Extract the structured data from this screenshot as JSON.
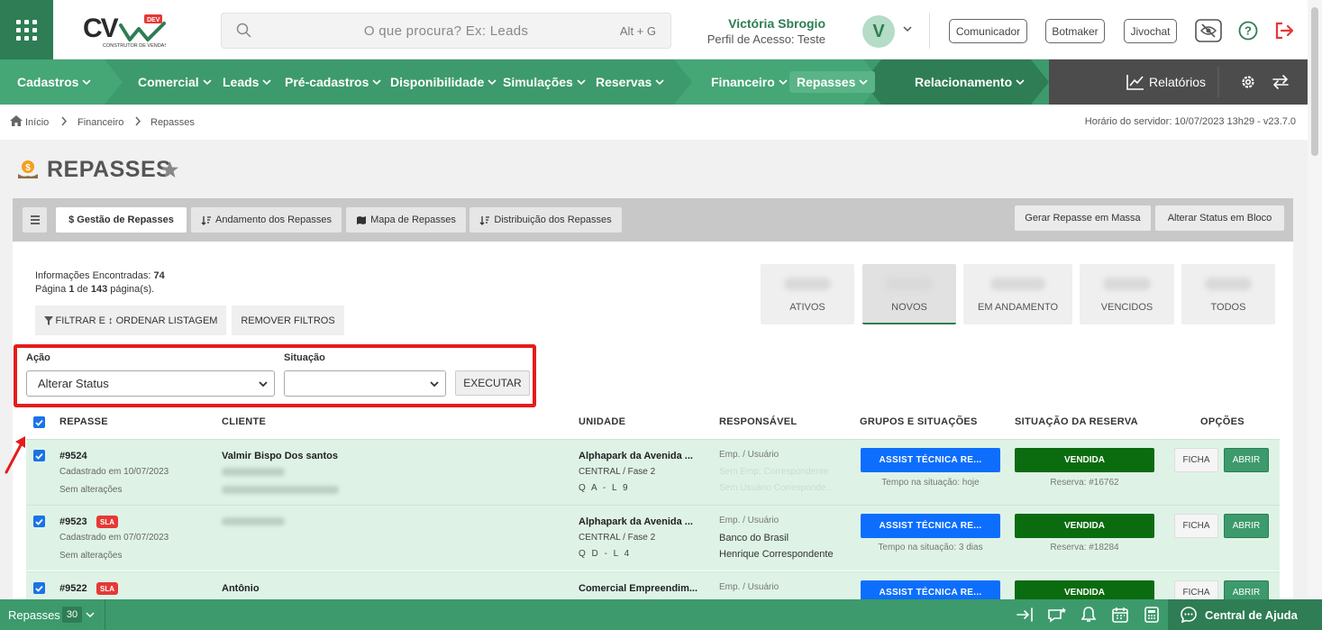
{
  "header": {
    "search_placeholder": "O que procura? Ex: Leads",
    "search_shortcut": "Alt + G",
    "user_name": "Victória Sbrogio",
    "user_profile": "Perfil de Acesso: Teste",
    "avatar_initial": "V",
    "buttons": [
      "Comunicador",
      "Botmaker",
      "Jivochat"
    ],
    "icons": [
      "eye-off-icon",
      "help-icon",
      "logout-icon"
    ]
  },
  "logo": {
    "text": "CV",
    "badge": "DEV",
    "subtitle": "CONSTRUTOR DE VENDAS"
  },
  "nav": {
    "items": [
      "Cadastros",
      "Comercial",
      "Leads",
      "Pré-cadastros",
      "Disponibilidade",
      "Simulações",
      "Reservas",
      "Financeiro",
      "Repasses",
      "Relacionamento"
    ],
    "active": "Repasses",
    "reports": "Relatórios",
    "colors": {
      "dark": "#2e7d54",
      "mid": "#3d9a6c",
      "light": "#45a676"
    }
  },
  "breadcrumb": {
    "items": [
      "Início",
      "Financeiro",
      "Repasses"
    ],
    "server_time": "Horário do servidor: 10/07/2023 13h29 - v23.7.0"
  },
  "page": {
    "title": "REPASSES"
  },
  "tabs": [
    "$ Gestão de Repasses",
    "Andamento dos Repasses",
    "Mapa de Repasses",
    "Distribuição dos Repasses"
  ],
  "tab_actions": [
    "Gerar Repasse em Massa",
    "Alterar Status em Bloco"
  ],
  "info": {
    "found_label": "Informações Encontradas:",
    "found_count": "74",
    "page_label": "Página",
    "page_current": "1",
    "page_of": "de",
    "page_total": "143",
    "page_suffix": "página(s)."
  },
  "filters": {
    "filter_button": "FILTRAR E ↕ ORDENAR LISTAGEM",
    "clear_button": "REMOVER FILTROS"
  },
  "status_cards": [
    "ATIVOS",
    "NOVOS",
    "EM ANDAMENTO",
    "VENCIDOS",
    "TODOS"
  ],
  "action_form": {
    "acao_label": "Ação",
    "acao_value": "Alterar Status",
    "situacao_label": "Situação",
    "situacao_value": "",
    "execute_label": "EXECUTAR"
  },
  "table": {
    "headers": [
      "REPASSE",
      "CLIENTE",
      "UNIDADE",
      "RESPONSÁVEL",
      "GRUPOS E SITUAÇÕES",
      "SITUAÇÃO DA RESERVA",
      "OPÇÕES"
    ],
    "rows": [
      {
        "id": "#9524",
        "sla": "",
        "created": "Cadastrado em 10/07/2023",
        "changes": "Sem alterações",
        "client": "Valmir Bispo Dos santos",
        "unit": "Alphapark da Avenida ...",
        "unit_sub": "CENTRAL / Fase 2",
        "unit_code": "Q A - L 9",
        "resp_label": "Emp. / Usuário",
        "resp1": "Sem Emp. Correspondente",
        "resp2": "Sem Usuário Corresponde...",
        "group": "ASSIST TÉCNICA RE...",
        "group_time": "Tempo na situação: hoje",
        "status": "VENDIDA",
        "reserva": "Reserva: #16762",
        "ficha": "FICHA",
        "abrir": "ABRIR"
      },
      {
        "id": "#9523",
        "sla": "SLA",
        "created": "Cadastrado em 07/07/2023",
        "changes": "Sem alterações",
        "client": "",
        "unit": "Alphapark da Avenida ...",
        "unit_sub": "CENTRAL / Fase 2",
        "unit_code": "Q D - L 4",
        "resp_label": "Emp. / Usuário",
        "resp1": "Banco do Brasil",
        "resp2": "Henrique Correspondente",
        "group": "ASSIST TÉCNICA RE...",
        "group_time": "Tempo na situação: 3 dias",
        "status": "VENDIDA",
        "reserva": "Reserva: #18284",
        "ficha": "FICHA",
        "abrir": "ABRIR"
      },
      {
        "id": "#9522",
        "sla": "SLA",
        "created": "",
        "changes": "",
        "client": "Antônio",
        "unit": "Comercial Empreendim...",
        "unit_sub": "",
        "unit_code": "",
        "resp_label": "Emp. / Usuário",
        "resp1": "",
        "resp2": "",
        "group": "ASSIST TÉCNICA RE...",
        "group_time": "",
        "status": "VENDIDA",
        "reserva": "",
        "ficha": "FICHA",
        "abrir": "ABRIR"
      }
    ]
  },
  "footer": {
    "label": "Repasses",
    "count": "30",
    "help": "Central de Ajuda"
  }
}
